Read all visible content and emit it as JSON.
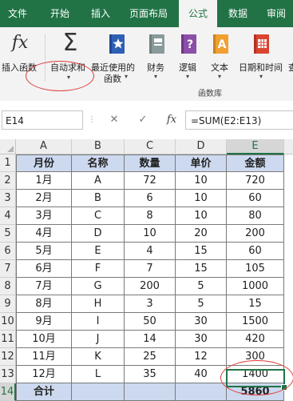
{
  "ribbon_tabs": [
    "文件",
    "开始",
    "插入",
    "页面布局",
    "公式",
    "数据",
    "审阅"
  ],
  "ribbon_buttons": {
    "insert_function": "插入函数",
    "autosum": "自动求和",
    "recently_used_1": "最近使用的",
    "recently_used_2": "函数",
    "financial": "财务",
    "logical": "逻辑",
    "text": "文本",
    "date_time": "日期和时间",
    "overflow": "查"
  },
  "ribbon_icons": {
    "insert_function": "fx-icon",
    "autosum": "sigma-icon",
    "recently_used": "star-book-icon",
    "financial": "book-icon",
    "logical": "question-book-icon",
    "text": "a-book-icon",
    "date_time": "calendar-book-icon"
  },
  "group_label": "函数库",
  "formula_bar": {
    "name_box": "E14",
    "cancel": "✕",
    "enter": "✓",
    "fx": "fx",
    "formula": "=SUM(E2:E13)"
  },
  "grid": {
    "columns": [
      "A",
      "B",
      "C",
      "D",
      "E"
    ],
    "row_numbers": [
      "1",
      "2",
      "3",
      "4",
      "5",
      "6",
      "7",
      "8",
      "9",
      "10",
      "11",
      "12",
      "13",
      "14"
    ],
    "selected_cell": "E14",
    "rows": [
      [
        "月份",
        "名称",
        "数量",
        "单价",
        "金额"
      ],
      [
        "1月",
        "A",
        "72",
        "10",
        "720"
      ],
      [
        "2月",
        "B",
        "6",
        "10",
        "60"
      ],
      [
        "3月",
        "C",
        "8",
        "10",
        "80"
      ],
      [
        "4月",
        "D",
        "10",
        "20",
        "200"
      ],
      [
        "5月",
        "E",
        "4",
        "15",
        "60"
      ],
      [
        "6月",
        "F",
        "7",
        "15",
        "105"
      ],
      [
        "7月",
        "G",
        "200",
        "5",
        "1000"
      ],
      [
        "8月",
        "H",
        "3",
        "5",
        "15"
      ],
      [
        "9月",
        "I",
        "50",
        "30",
        "1500"
      ],
      [
        "10月",
        "J",
        "14",
        "30",
        "420"
      ],
      [
        "11月",
        "K",
        "25",
        "12",
        "300"
      ],
      [
        "12月",
        "L",
        "35",
        "40",
        "1400"
      ],
      [
        "合计",
        "",
        "",
        "",
        "5860"
      ]
    ]
  },
  "colors": {
    "excel_green": "#217346",
    "header_fill": "#ccd9ef",
    "annotation_red": "#e03a3a"
  }
}
